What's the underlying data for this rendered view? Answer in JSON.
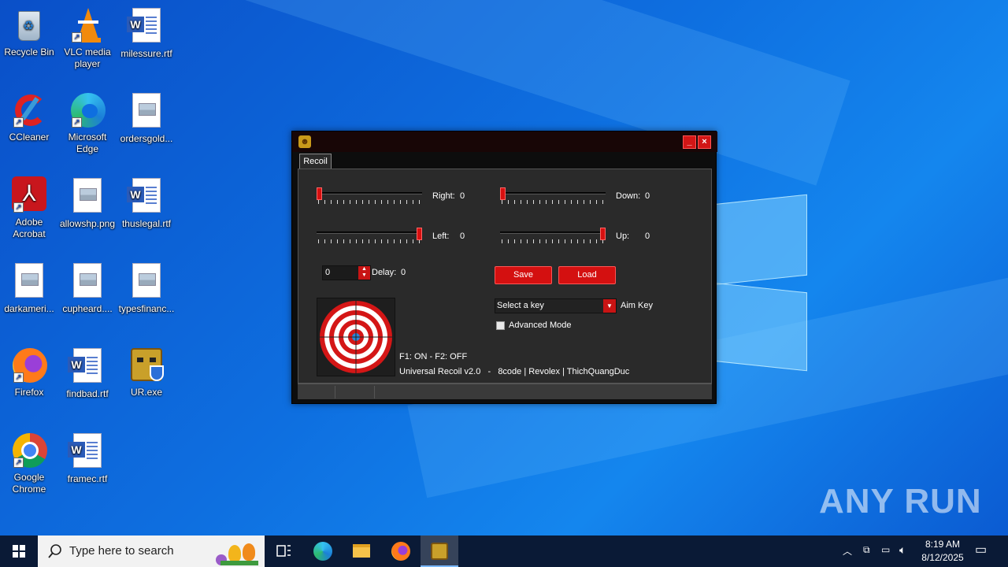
{
  "desktop": {
    "icons": [
      {
        "label": "Recycle Bin",
        "icon": "recycle-bin-icon"
      },
      {
        "label": "VLC media player",
        "icon": "vlc-icon"
      },
      {
        "label": "milessure.rtf",
        "icon": "word-document-icon"
      },
      {
        "label": "CCleaner",
        "icon": "ccleaner-icon"
      },
      {
        "label": "Microsoft Edge",
        "icon": "edge-icon"
      },
      {
        "label": "ordersgold...",
        "icon": "image-file-icon"
      },
      {
        "label": "Adobe Acrobat",
        "icon": "acrobat-icon"
      },
      {
        "label": "allowshp.png",
        "icon": "image-file-icon"
      },
      {
        "label": "thuslegal.rtf",
        "icon": "word-document-icon"
      },
      {
        "label": "darkameri...",
        "icon": "image-file-icon"
      },
      {
        "label": "cupheard....",
        "icon": "image-file-icon"
      },
      {
        "label": "typesfinanc...",
        "icon": "image-file-icon"
      },
      {
        "label": "Firefox",
        "icon": "firefox-icon"
      },
      {
        "label": "findbad.rtf",
        "icon": "word-document-icon"
      },
      {
        "label": "UR.exe",
        "icon": "ur-exe-icon"
      },
      {
        "label": "Google Chrome",
        "icon": "chrome-icon"
      },
      {
        "label": "framec.rtf",
        "icon": "word-document-icon"
      }
    ]
  },
  "app": {
    "tab_label": "Recoil",
    "minimize_glyph": "_",
    "close_glyph": "×",
    "sliders": {
      "right": {
        "label": "Right:",
        "value": "0",
        "position": 0
      },
      "down": {
        "label": "Down:",
        "value": "0",
        "position": 0
      },
      "left": {
        "label": "Left:",
        "value": "0",
        "position": 1
      },
      "up": {
        "label": "Up:",
        "value": "0",
        "position": 1
      }
    },
    "delay": {
      "input_value": "0",
      "label": "Delay:",
      "value": "0"
    },
    "save_label": "Save",
    "load_label": "Load",
    "aim_key": {
      "placeholder": "Select a key",
      "label": "Aim Key"
    },
    "advanced_mode": {
      "label": "Advanced Mode",
      "checked": false
    },
    "hotkey_info": "F1: ON - F2: OFF",
    "credits": "Universal Recoil v2.0   -   8code | Revolex | ThichQuangDuc"
  },
  "taskbar": {
    "search_placeholder": "Type here to search",
    "pinned": [
      "task-view-icon",
      "edge-icon",
      "file-explorer-icon",
      "firefox-icon",
      "ur-app-icon"
    ],
    "time": "8:19 AM",
    "date": "8/12/2025"
  },
  "watermark": "ANY RUN",
  "colors": {
    "accent_red": "#d41010",
    "panel_bg": "#2a2a2a",
    "desktop_blue": "#0e6fe0"
  }
}
